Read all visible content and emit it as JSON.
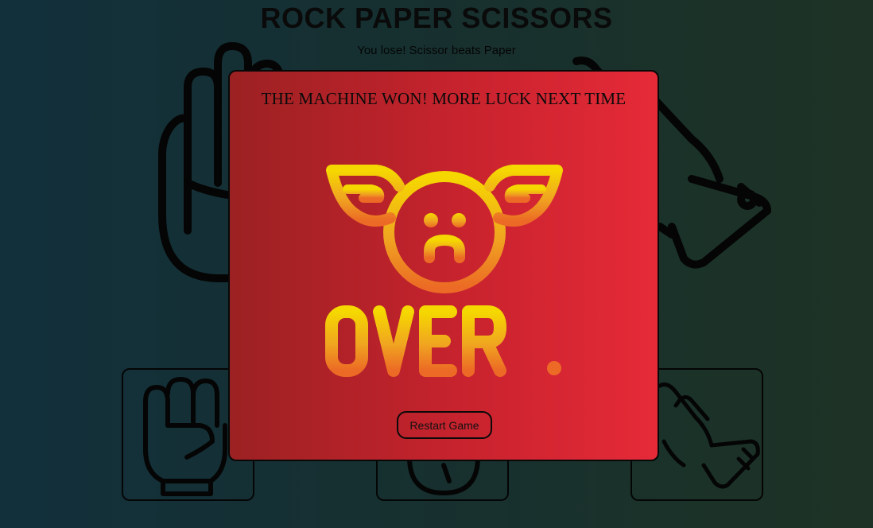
{
  "header": {
    "title": "ROCK PAPER SCISSORS",
    "result_text": "You lose! Scissor beats Paper"
  },
  "background_choices": {
    "player_hand_icon": "paper-hand-icon",
    "machine_hand_icon": "scissors-hand-icon"
  },
  "choices": [
    {
      "id": "rock",
      "icon": "rock-fist-icon"
    },
    {
      "id": "paper",
      "icon": "paper-icon"
    },
    {
      "id": "scissors",
      "icon": "scissors-hand-icon"
    }
  ],
  "modal": {
    "message": "THE MACHINE WON! MORE LUCK NEXT TIME",
    "image_icon": "game-over-sad-angel-icon",
    "image_text": "OVER!",
    "restart_label": "Restart Game"
  },
  "colors": {
    "background_left": "#12303c",
    "background_right": "#1e3325",
    "modal_left": "#9c2122",
    "modal_right": "#e62a38",
    "over_top": "#f5d800",
    "over_bottom": "#ec6a25"
  }
}
